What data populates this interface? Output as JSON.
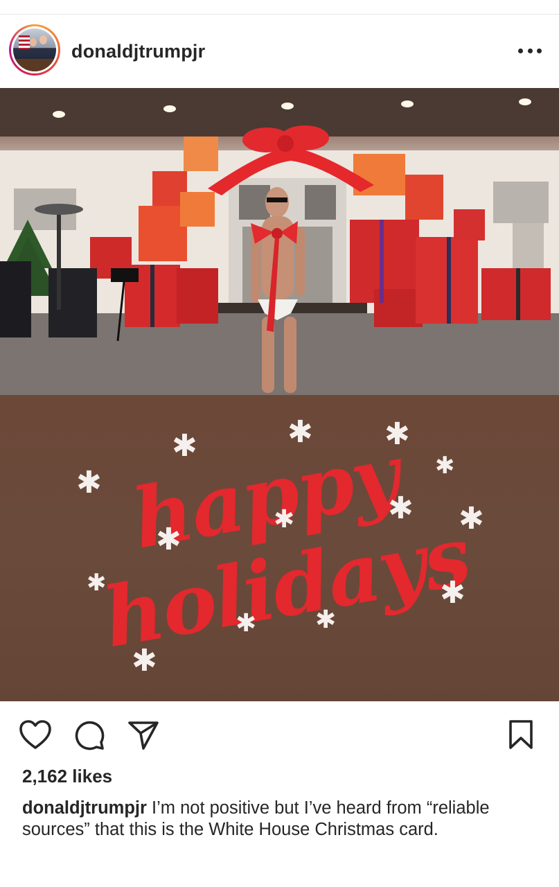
{
  "post": {
    "username": "donaldjtrumpjr",
    "more_icon": "ellipsis-icon",
    "likes_text": "2,162 likes",
    "caption_user": "donaldjtrumpjr",
    "caption_text": " I’m not positive but I’ve heard from “reliable sources” that this is the White House Christmas card."
  },
  "image": {
    "greeting_line1": "happy",
    "greeting_line2": "holidays",
    "accent_color": "#e3282e",
    "background_color": "#6c4838"
  },
  "actions": {
    "like_icon": "heart-icon",
    "comment_icon": "comment-icon",
    "share_icon": "send-icon",
    "save_icon": "bookmark-icon"
  }
}
